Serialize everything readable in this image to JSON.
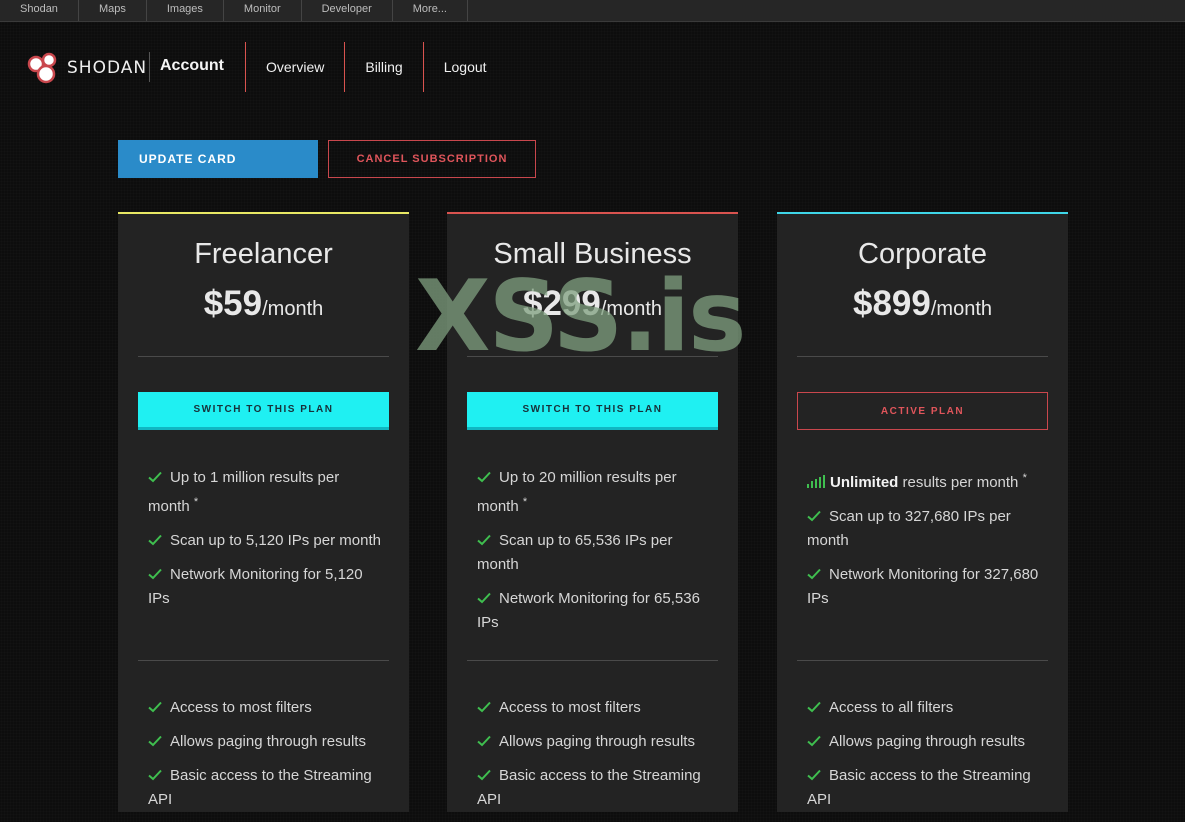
{
  "topnav": [
    "Shodan",
    "Maps",
    "Images",
    "Monitor",
    "Developer",
    "More..."
  ],
  "header": {
    "logo_text": "SHODAN",
    "section": "Account",
    "nav": [
      "Overview",
      "Billing",
      "Logout"
    ]
  },
  "actions": {
    "update_card": "UPDATE CARD",
    "cancel_subscription": "CANCEL SUBSCRIPTION"
  },
  "plans": [
    {
      "name": "Freelancer",
      "price": "$59",
      "period": "/month",
      "accent": "#e8e864",
      "button": "SWITCH TO THIS PLAN",
      "active": false,
      "features_a": [
        {
          "pre": "Up to 1 million results per month",
          "bold": "",
          "post": "",
          "sup": "*"
        },
        {
          "pre": "Scan up to 5,120 IPs per month",
          "bold": "",
          "post": "",
          "sup": ""
        },
        {
          "pre": "Network Monitoring for 5,120 IPs",
          "bold": "",
          "post": "",
          "sup": ""
        }
      ],
      "features_b": [
        "Access to most filters",
        "Allows paging through results",
        "Basic access to the Streaming API"
      ]
    },
    {
      "name": "Small Business",
      "price": "$299",
      "period": "/month",
      "accent": "#d9534f",
      "button": "SWITCH TO THIS PLAN",
      "active": false,
      "features_a": [
        {
          "pre": "Up to 20 million results per month",
          "bold": "",
          "post": "",
          "sup": "*"
        },
        {
          "pre": "Scan up to 65,536 IPs per month",
          "bold": "",
          "post": "",
          "sup": ""
        },
        {
          "pre": "Network Monitoring for 65,536 IPs",
          "bold": "",
          "post": "",
          "sup": ""
        }
      ],
      "features_b": [
        "Access to most filters",
        "Allows paging through results",
        "Basic access to the Streaming API"
      ]
    },
    {
      "name": "Corporate",
      "price": "$899",
      "period": "/month",
      "accent": "#3fd6e8",
      "button": "ACTIVE PLAN",
      "active": true,
      "features_a": [
        {
          "pre": "",
          "bold": "Unlimited",
          "post": " results per month",
          "sup": "*",
          "icon": "signal-bars-icon"
        },
        {
          "pre": "Scan up to 327,680 IPs per month",
          "bold": "",
          "post": "",
          "sup": ""
        },
        {
          "pre": "Network Monitoring for 327,680 IPs",
          "bold": "",
          "post": "",
          "sup": ""
        }
      ],
      "features_b": [
        "Access to all filters",
        "Allows paging through results",
        "Basic access to the Streaming API"
      ]
    }
  ],
  "colors": {
    "check": "#3fbf4f",
    "primary_button": "#2a8bc9",
    "switch_button": "#1ff0f2",
    "danger": "#d9534f"
  },
  "watermark": "XSS.is"
}
